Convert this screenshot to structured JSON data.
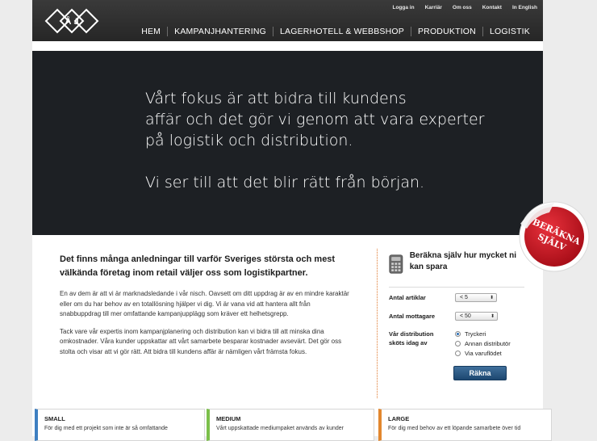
{
  "header": {
    "logo_text": "Å J",
    "top_links": [
      "Logga in",
      "Karriär",
      "Om oss",
      "Kontakt",
      "In English"
    ],
    "main_nav": [
      "HEM",
      "KAMPANJHANTERING",
      "LAGERHOTELL & WEBBSHOP",
      "PRODUKTION",
      "LOGISTIK"
    ]
  },
  "hero": {
    "line1": "Vårt fokus är att bidra till kundens",
    "line2": "affär och det gör vi genom att vara experter",
    "line3": "på logistik och distribution.",
    "line4": "Vi ser till att det blir rätt från början."
  },
  "sticker": {
    "line1": "Beräkna",
    "line2": "själv",
    "color": "#c8101e"
  },
  "intro": {
    "heading": "Det finns många anledningar till varför Sveriges största och mest välkända företag inom retail väljer oss som logistikpartner.",
    "paragraph1": "En av dem är att vi är marknadsledande i vår nisch. Oavsett om ditt uppdrag är av en mindre karaktär eller om du har behov av en totallösning hjälper vi dig. Vi är vana vid att hantera allt från snabbuppdrag till mer omfattande kampanjupplägg som kräver ett helhetsgrepp.",
    "paragraph2": "Tack vare vår expertis inom kampanjplanering och distribution kan vi bidra till att minska dina omkostnader. Våra kunder uppskattar att vårt samarbete besparar kostnader avsevärt. Det gör oss stolta och visar att vi gör rätt. Att bidra till kundens affär är nämligen vårt främsta fokus."
  },
  "calculator": {
    "title": "Beräkna själv hur mycket ni kan spara",
    "icon": "calculator-icon",
    "articles_label": "Antal artiklar",
    "articles_value": "< 5",
    "recipients_label": "Antal mottagare",
    "recipients_value": "< 50",
    "distribution_label": "Vår distribution sköts idag av",
    "options": [
      "Tryckeri",
      "Annan distributör",
      "Via varuflödet"
    ],
    "selected_option": 0,
    "button_label": "Räkna",
    "accent": "#e07b32"
  },
  "packages": [
    {
      "title": "SMALL",
      "desc": "För dig med ett projekt som inte är så omfattande",
      "color": "#3e7fc1"
    },
    {
      "title": "MEDIUM",
      "desc": "Vårt uppskattade mediumpaket används av kunder",
      "color": "#7bbf4a"
    },
    {
      "title": "LARGE",
      "desc": "För dig med behov av ett löpande samarbete över tid",
      "color": "#e2872e"
    }
  ]
}
